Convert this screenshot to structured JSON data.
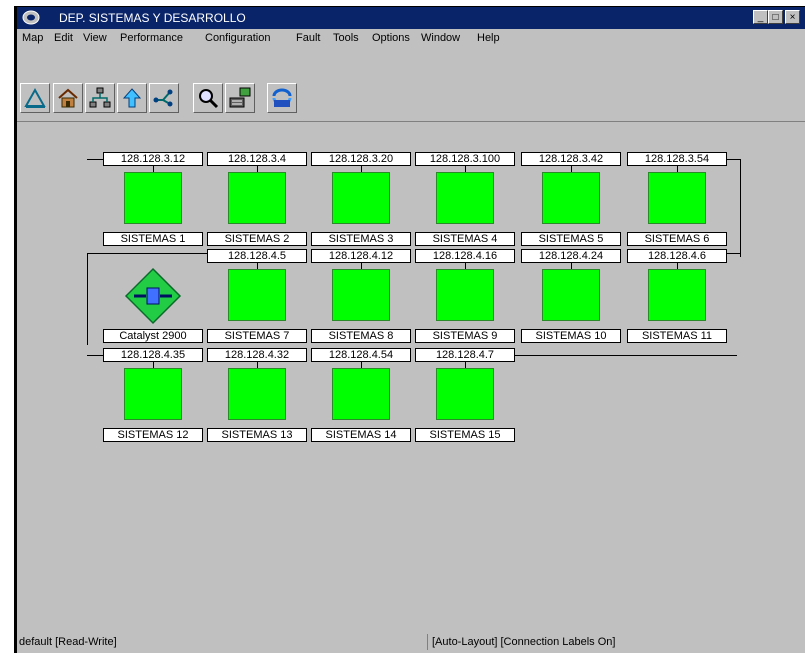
{
  "window": {
    "title": "DEP. SISTEMAS Y DESARROLLO",
    "minimize": "_",
    "restore": "□",
    "close": "×"
  },
  "menu": [
    "Map",
    "Edit",
    "View",
    "Performance",
    "Configuration",
    "Fault",
    "Tools",
    "Options",
    "Window",
    "Help"
  ],
  "toolbar": {
    "buttons": [
      "ruler-icon",
      "home-icon",
      "hierarchy-icon",
      "up-arrow-icon",
      "network-icon",
      "zoom-icon",
      "monitor-icon",
      "digital-link-icon"
    ]
  },
  "map": {
    "rows": [
      {
        "nodes": [
          {
            "ip": "128.128.3.12",
            "name": "SISTEMAS 1"
          },
          {
            "ip": "128.128.3.4",
            "name": "SISTEMAS 2"
          },
          {
            "ip": "128.128.3.20",
            "name": "SISTEMAS 3"
          },
          {
            "ip": "128.128.3.100",
            "name": "SISTEMAS 4"
          },
          {
            "ip": "128.128.3.42",
            "name": "SISTEMAS 5"
          },
          {
            "ip": "128.128.3.54",
            "name": "SISTEMAS 6"
          }
        ]
      },
      {
        "switch": {
          "name": "Catalyst 2900"
        },
        "nodes": [
          {
            "ip": "128.128.4.5",
            "name": "SISTEMAS 7"
          },
          {
            "ip": "128.128.4.12",
            "name": "SISTEMAS 8"
          },
          {
            "ip": "128.128.4.16",
            "name": "SISTEMAS 9"
          },
          {
            "ip": "128.128.4.24",
            "name": "SISTEMAS 10"
          },
          {
            "ip": "128.128.4.6",
            "name": "SISTEMAS 11"
          }
        ]
      },
      {
        "nodes": [
          {
            "ip": "128.128.4.35",
            "name": "SISTEMAS 12"
          },
          {
            "ip": "128.128.4.32",
            "name": "SISTEMAS 13"
          },
          {
            "ip": "128.128.4.54",
            "name": "SISTEMAS 14"
          },
          {
            "ip": "128.128.4.7",
            "name": "SISTEMAS 15"
          }
        ]
      }
    ],
    "colors": {
      "device": "#00ff00",
      "switch": "#22cc44",
      "background": "#c0c0c0"
    }
  },
  "status": {
    "left": "default [Read-Write]",
    "right": "[Auto-Layout] [Connection Labels On]"
  }
}
